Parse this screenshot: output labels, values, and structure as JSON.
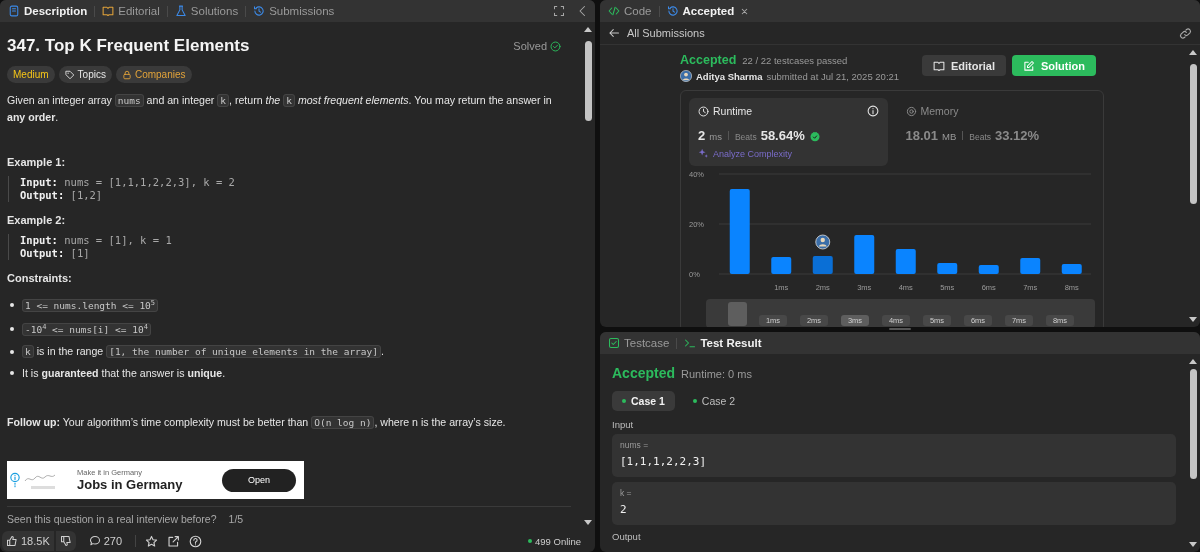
{
  "problem_panel": {
    "tabs": [
      {
        "label": "Description",
        "kind": "description",
        "selected": true
      },
      {
        "label": "Editorial",
        "kind": "editorial",
        "selected": false
      },
      {
        "label": "Solutions",
        "kind": "solutions",
        "selected": false
      },
      {
        "label": "Submissions",
        "kind": "submissions",
        "selected": false
      }
    ],
    "title": "347. Top K Frequent Elements",
    "status": "Solved",
    "tags": [
      {
        "label": "Medium",
        "kind": "difficulty"
      },
      {
        "label": "Topics",
        "kind": "topics"
      },
      {
        "label": "Companies",
        "kind": "companies"
      }
    ],
    "statement": [
      {
        "kind": "text",
        "text": "Given an integer array "
      },
      {
        "kind": "code",
        "text": "nums"
      },
      {
        "kind": "text",
        "text": " and an integer "
      },
      {
        "kind": "code",
        "text": "k"
      },
      {
        "kind": "text",
        "text": ", return *the* "
      },
      {
        "kind": "code",
        "text": "k"
      },
      {
        "kind": "text",
        "text": " *most frequent elements*. You may return the answer in **any order**."
      }
    ],
    "examples": [
      {
        "heading": "Example 1:",
        "input_label": "Input:",
        "input": "nums = [1,1,1,2,2,3], k = 2",
        "output_label": "Output:",
        "output": "[1,2]"
      },
      {
        "heading": "Example 2:",
        "input_label": "Input:",
        "input": "nums = [1], k = 1",
        "output_label": "Output:",
        "output": "[1]"
      }
    ],
    "constraints_heading": "Constraints:",
    "constraints": [
      [
        {
          "kind": "code",
          "text": "1 <= nums.length <= 10$^{5}$"
        }
      ],
      [
        {
          "kind": "code",
          "text": "-10$^{4}$ <= nums[i] <= 10$^{4}$"
        }
      ],
      [
        {
          "kind": "code",
          "text": "k"
        },
        {
          "kind": "text",
          "text": " is in the range "
        },
        {
          "kind": "code",
          "text": "[1, the number of unique elements in the array]"
        },
        {
          "kind": "text",
          "text": "."
        }
      ],
      [
        {
          "kind": "text",
          "text": "It is **guaranteed** that the answer is **unique**."
        }
      ]
    ],
    "follow_up": [
      {
        "kind": "text",
        "text": "**Follow up:** Your algorithm’s time complexity must be better than "
      },
      {
        "kind": "code",
        "text": "O(n log n)"
      },
      {
        "kind": "text",
        "text": ", where n is the array’s size."
      }
    ],
    "ad": {
      "tagline": "Make it in Germany",
      "headline": "Jobs in Germany",
      "button": "Open"
    },
    "interview_prompt": "Seen this question in a real interview before?",
    "interview_count": "1/5",
    "footer": {
      "likes": "18.5K",
      "comments": "270",
      "online": "499 Online"
    }
  },
  "submission_panel": {
    "tabs": [
      {
        "label": "Code",
        "kind": "code",
        "selected": false,
        "closable": false
      },
      {
        "label": "Accepted",
        "kind": "history",
        "selected": true,
        "closable": true
      }
    ],
    "back_link": "All Submissions",
    "verdict": "Accepted",
    "testcases": "22 / 22 testcases passed",
    "author": "Aditya Sharma",
    "submitted": "submitted at Jul 21, 2025 20:21",
    "buttons": [
      {
        "label": "Editorial",
        "kind": "secondary"
      },
      {
        "label": "Solution",
        "kind": "primary"
      }
    ],
    "metrics": [
      {
        "kind": "runtime",
        "title": "Runtime",
        "value": "2",
        "unit": "ms",
        "beats_label": "Beats",
        "beats": "58.64%",
        "selected": true,
        "action": "Analyze Complexity"
      },
      {
        "kind": "memory",
        "title": "Memory",
        "value": "18.01",
        "unit": "MB",
        "beats_label": "Beats",
        "beats": "33.12%",
        "selected": false
      }
    ],
    "chart_data": {
      "type": "bar",
      "categories": [
        null,
        "1ms",
        "2ms",
        "3ms",
        "4ms",
        "5ms",
        "6ms",
        "7ms",
        "8ms"
      ],
      "series": [
        {
          "color": "#0a84ff",
          "values": [
            34,
            6.8,
            null,
            15.6,
            10,
            4.4,
            3.6,
            6.4,
            4
          ]
        },
        {
          "color": "#0a6fd6",
          "values": [
            null,
            null,
            7.2,
            null,
            null,
            null,
            null,
            null,
            null
          ]
        }
      ],
      "ylim": [
        0,
        40
      ],
      "yticks": [
        {
          "value": 0,
          "label": "0%"
        },
        {
          "value": 20,
          "label": "20%"
        },
        {
          "value": 40,
          "label": "40%"
        }
      ]
    },
    "navigator": [
      {
        "label": "1ms",
        "selected": false
      },
      {
        "label": "2ms",
        "selected": false
      },
      {
        "label": "3ms",
        "selected": true
      },
      {
        "label": "4ms",
        "selected": false
      },
      {
        "label": "5ms",
        "selected": false
      },
      {
        "label": "6ms",
        "selected": false
      },
      {
        "label": "7ms",
        "selected": false
      },
      {
        "label": "8ms",
        "selected": false
      }
    ]
  },
  "result_panel": {
    "tabs": [
      {
        "label": "Testcase",
        "kind": "testcase",
        "selected": false
      },
      {
        "label": "Test Result",
        "kind": "terminal",
        "selected": true
      }
    ],
    "verdict": "Accepted",
    "runtime": "Runtime: 0 ms",
    "cases": [
      {
        "label": "Case 1",
        "selected": true
      },
      {
        "label": "Case 2",
        "selected": false
      }
    ],
    "input_label": "Input",
    "inputs": [
      {
        "name": "nums =",
        "value": "[1,1,1,2,2,3]"
      },
      {
        "name": "k =",
        "value": "2"
      }
    ],
    "output_label": "Output"
  }
}
